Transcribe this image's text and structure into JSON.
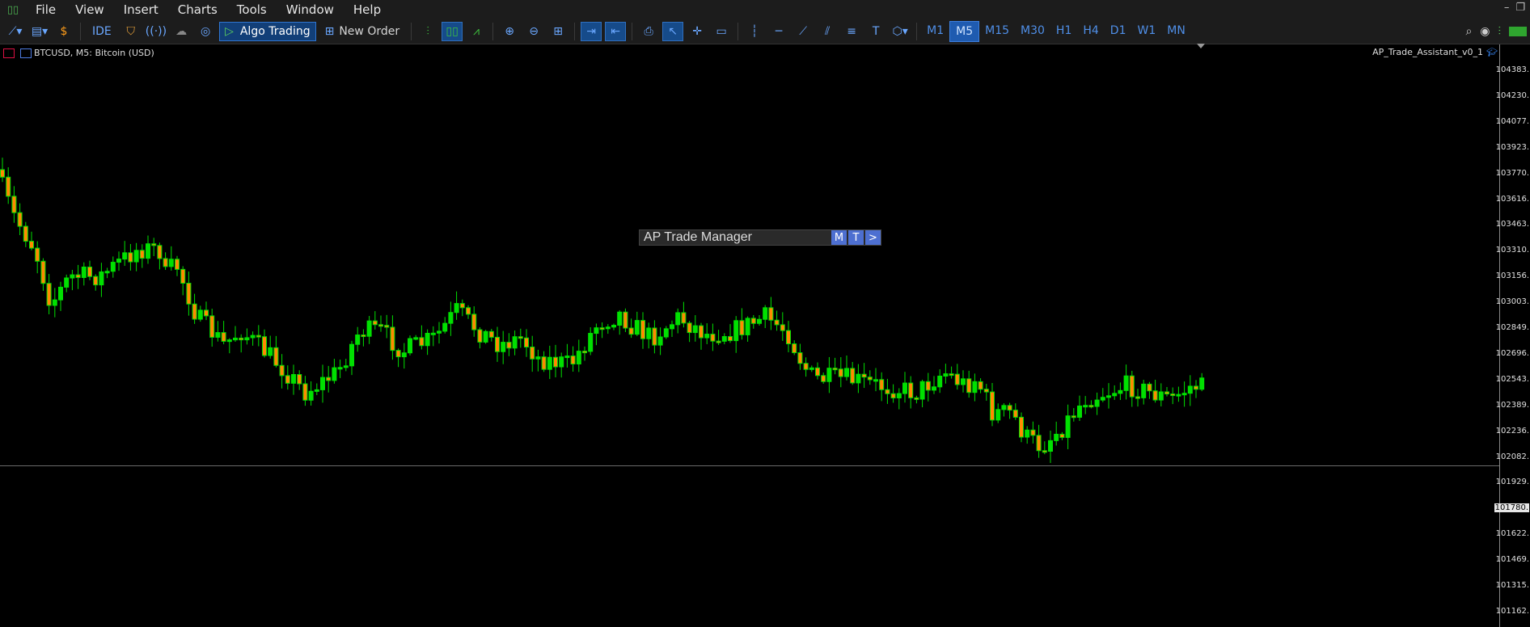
{
  "menu": [
    "File",
    "View",
    "Insert",
    "Charts",
    "Tools",
    "Window",
    "Help"
  ],
  "toolbar": {
    "ide_label": "IDE",
    "algo_label": "Algo Trading",
    "new_order_label": "New Order",
    "timeframes": [
      "M1",
      "M5",
      "M15",
      "M30",
      "H1",
      "H4",
      "D1",
      "W1",
      "MN"
    ],
    "active_timeframe": "M5"
  },
  "symbol": {
    "title": "BTCUSD, M5:  Bitcoin (USD)"
  },
  "expert": {
    "name": "AP_Trade_Assistant_v0_1"
  },
  "panel": {
    "title": "AP Trade Manager",
    "btn_m": "M",
    "btn_t": "T",
    "btn_next": ">"
  },
  "price_axis": {
    "labels": [
      "104383.",
      "104230.",
      "104077.",
      "103923.",
      "103770.",
      "103616.",
      "103463.",
      "103310.",
      "103156.",
      "103003.",
      "102849.",
      "102696.",
      "102543.",
      "102389.",
      "102236.",
      "102082.",
      "101929.",
      "101780.",
      "101622.",
      "101469.",
      "101315.",
      "101162."
    ],
    "current_label": "101780."
  },
  "colors": {
    "bull": "#00e000",
    "bear": "#ff8a00",
    "accent": "#1f5bb0"
  }
}
